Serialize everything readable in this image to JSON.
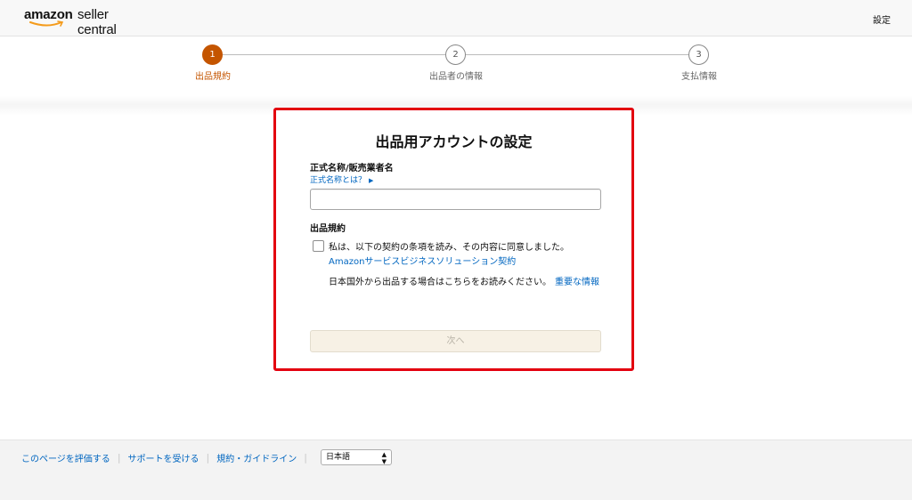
{
  "header": {
    "logo_amazon": "amazon",
    "logo_product": "seller central",
    "settings_label": "設定"
  },
  "steps": [
    {
      "number": "1",
      "label": "出品規約",
      "state": "active"
    },
    {
      "number": "2",
      "label": "出品者の情報",
      "state": "inactive"
    },
    {
      "number": "3",
      "label": "支払情報",
      "state": "inactive"
    }
  ],
  "form": {
    "title": "出品用アカウントの設定",
    "name_label": "正式名称/販売業者名",
    "name_help_link": "正式名称とは？",
    "name_value": "",
    "terms_label": "出品規約",
    "agree_text": "私は、以下の契約の条項を読み、その内容に同意しました。",
    "agree_checked": false,
    "agreement_link": "Amazonサービスビジネスソリューション契約",
    "notice_text": "日本国外から出品する場合はこちらをお読みください。",
    "notice_link": "重要な情報",
    "next_button": "次へ"
  },
  "footer": {
    "links": [
      "このページを評価する",
      "サポートを受ける",
      "規約・ガイドライン"
    ],
    "language": "日本語"
  },
  "colors": {
    "accent": "#c45500",
    "link": "#0066c0",
    "highlight_border": "#e3000f"
  }
}
